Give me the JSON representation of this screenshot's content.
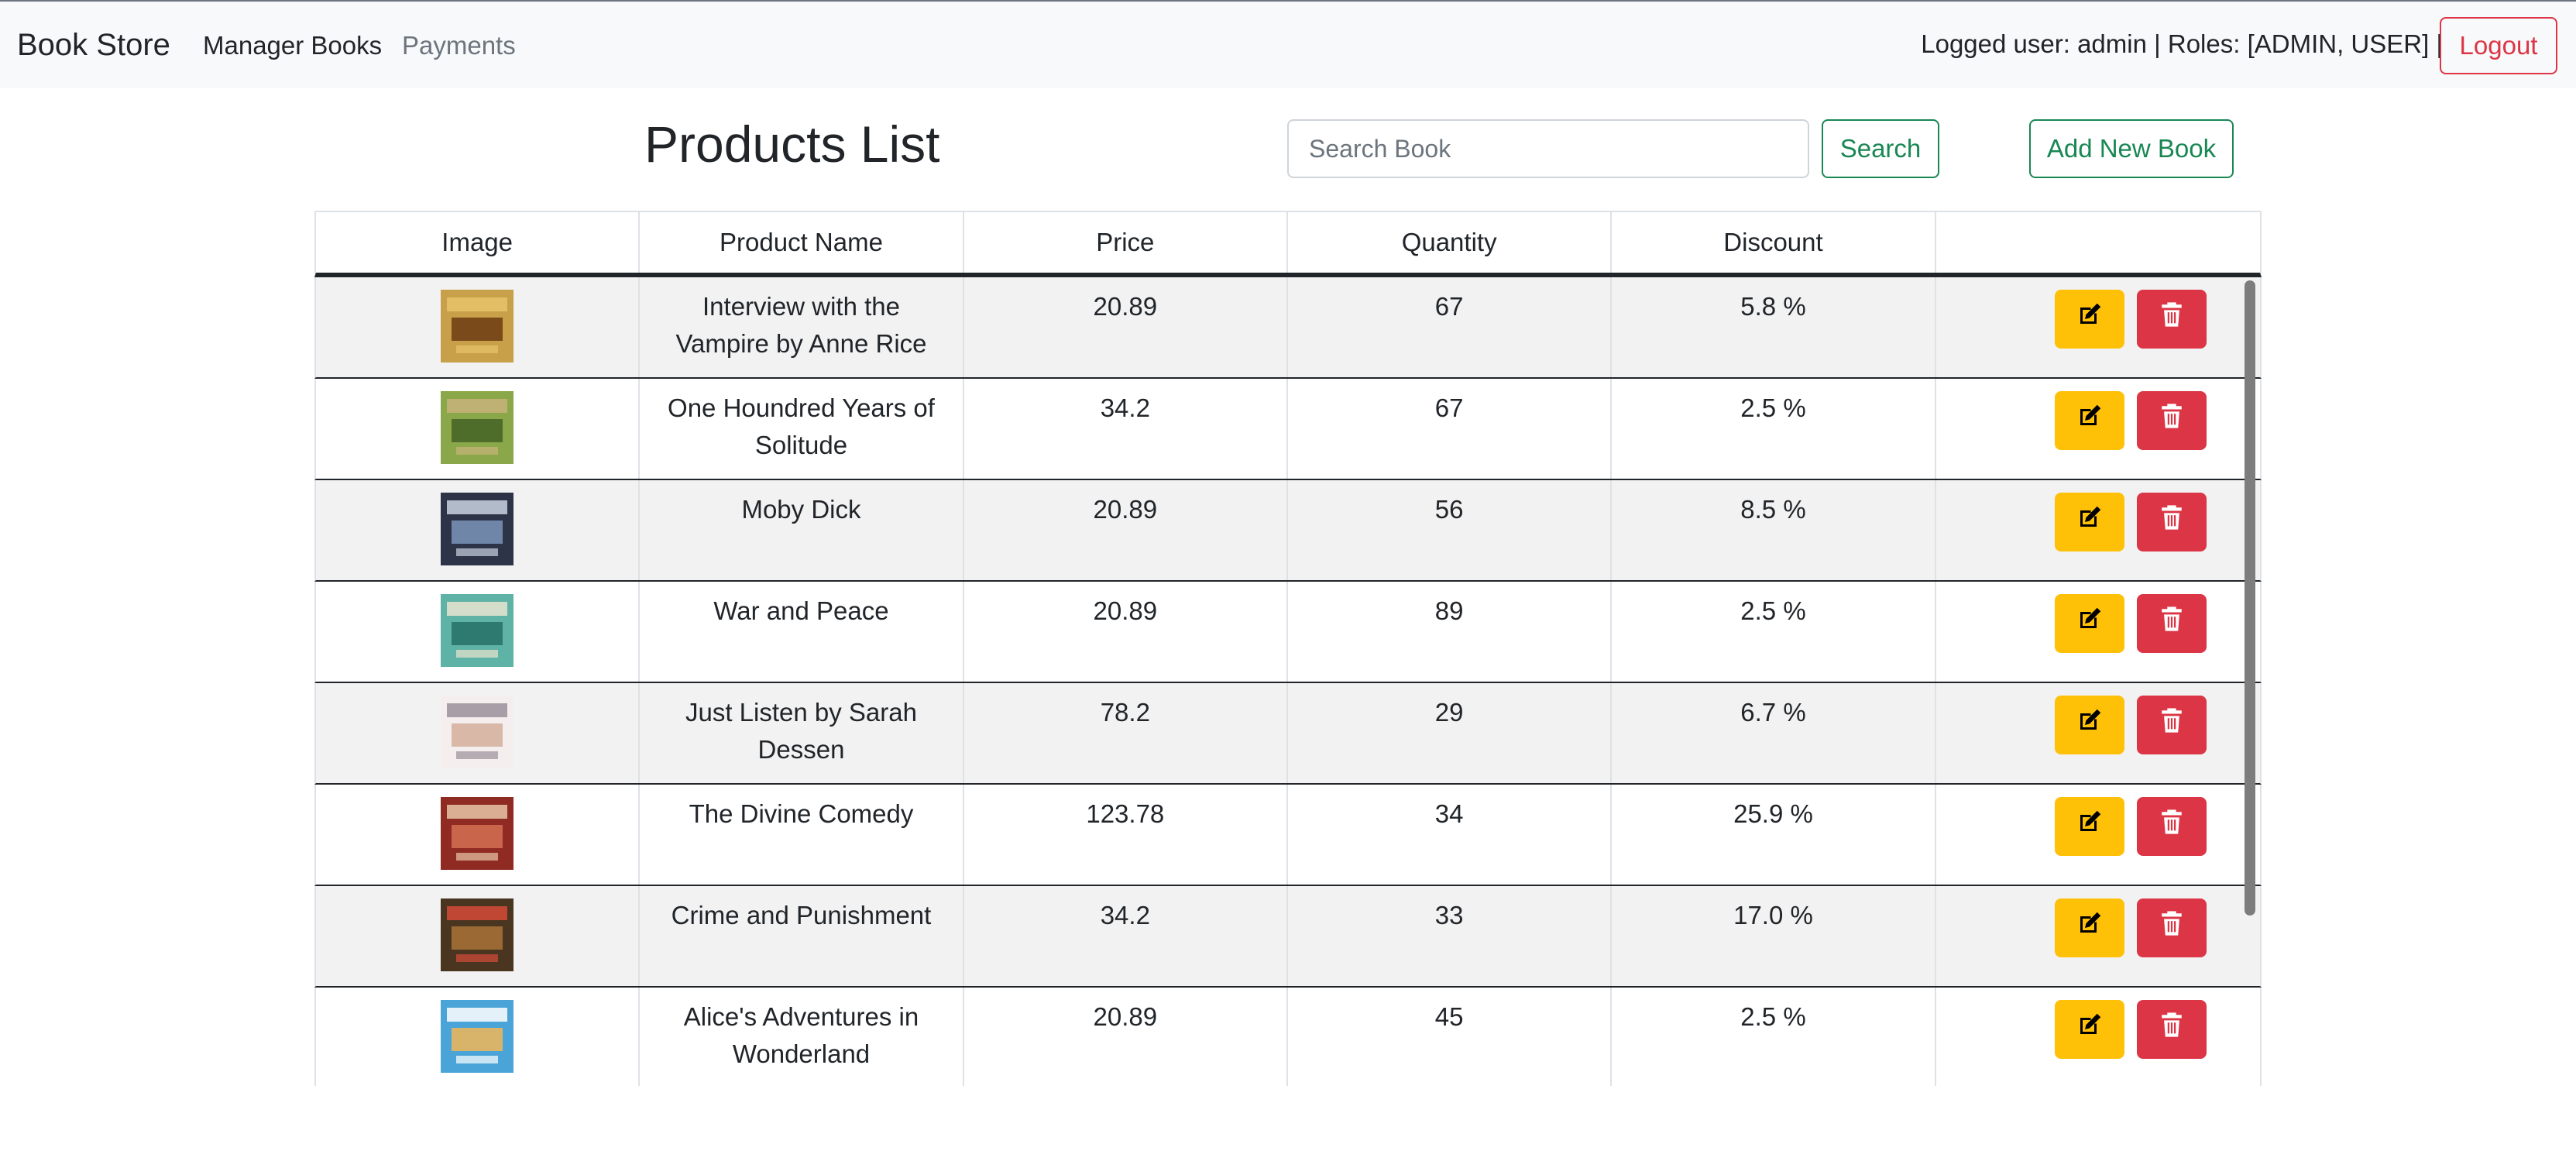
{
  "navbar": {
    "brand": "Book Store",
    "links": [
      "Manager Books",
      "Payments"
    ],
    "user_info": "Logged user: admin | Roles: [ADMIN, USER] |",
    "logout_label": "Logout"
  },
  "header": {
    "title": "Products List",
    "search_placeholder": "Search Book",
    "search_label": "Search",
    "add_label": "Add New Book"
  },
  "table": {
    "columns": [
      "Image",
      "Product Name",
      "Price",
      "Quantity",
      "Discount",
      ""
    ],
    "rows": [
      {
        "name": "Interview with the Vampire by Anne Rice",
        "price": "20.89",
        "quantity": "67",
        "discount": "5.8 %",
        "cover_icon": "book-cover-image"
      },
      {
        "name": "One Houndred Years of Solitude",
        "price": "34.2",
        "quantity": "67",
        "discount": "2.5 %",
        "cover_icon": "book-cover-image"
      },
      {
        "name": "Moby Dick",
        "price": "20.89",
        "quantity": "56",
        "discount": "8.5 %",
        "cover_icon": "book-cover-image"
      },
      {
        "name": "War and Peace",
        "price": "20.89",
        "quantity": "89",
        "discount": "2.5 %",
        "cover_icon": "book-cover-image"
      },
      {
        "name": "Just Listen by Sarah Dessen",
        "price": "78.2",
        "quantity": "29",
        "discount": "6.7 %",
        "cover_icon": "book-cover-image"
      },
      {
        "name": "The Divine Comedy",
        "price": "123.78",
        "quantity": "34",
        "discount": "25.9 %",
        "cover_icon": "book-cover-image"
      },
      {
        "name": "Crime and Punishment",
        "price": "34.2",
        "quantity": "33",
        "discount": "17.0 %",
        "cover_icon": "book-cover-image"
      },
      {
        "name": "Alice's Adventures in Wonderland",
        "price": "20.89",
        "quantity": "45",
        "discount": "2.5 %",
        "cover_icon": "book-cover-image"
      }
    ],
    "actions": {
      "edit_icon": "edit-icon",
      "delete_icon": "trash-icon"
    }
  },
  "colors": {
    "edit": "#ffc107",
    "delete": "#dc3545",
    "success": "#198754",
    "stripe": "#f2f2f2"
  }
}
